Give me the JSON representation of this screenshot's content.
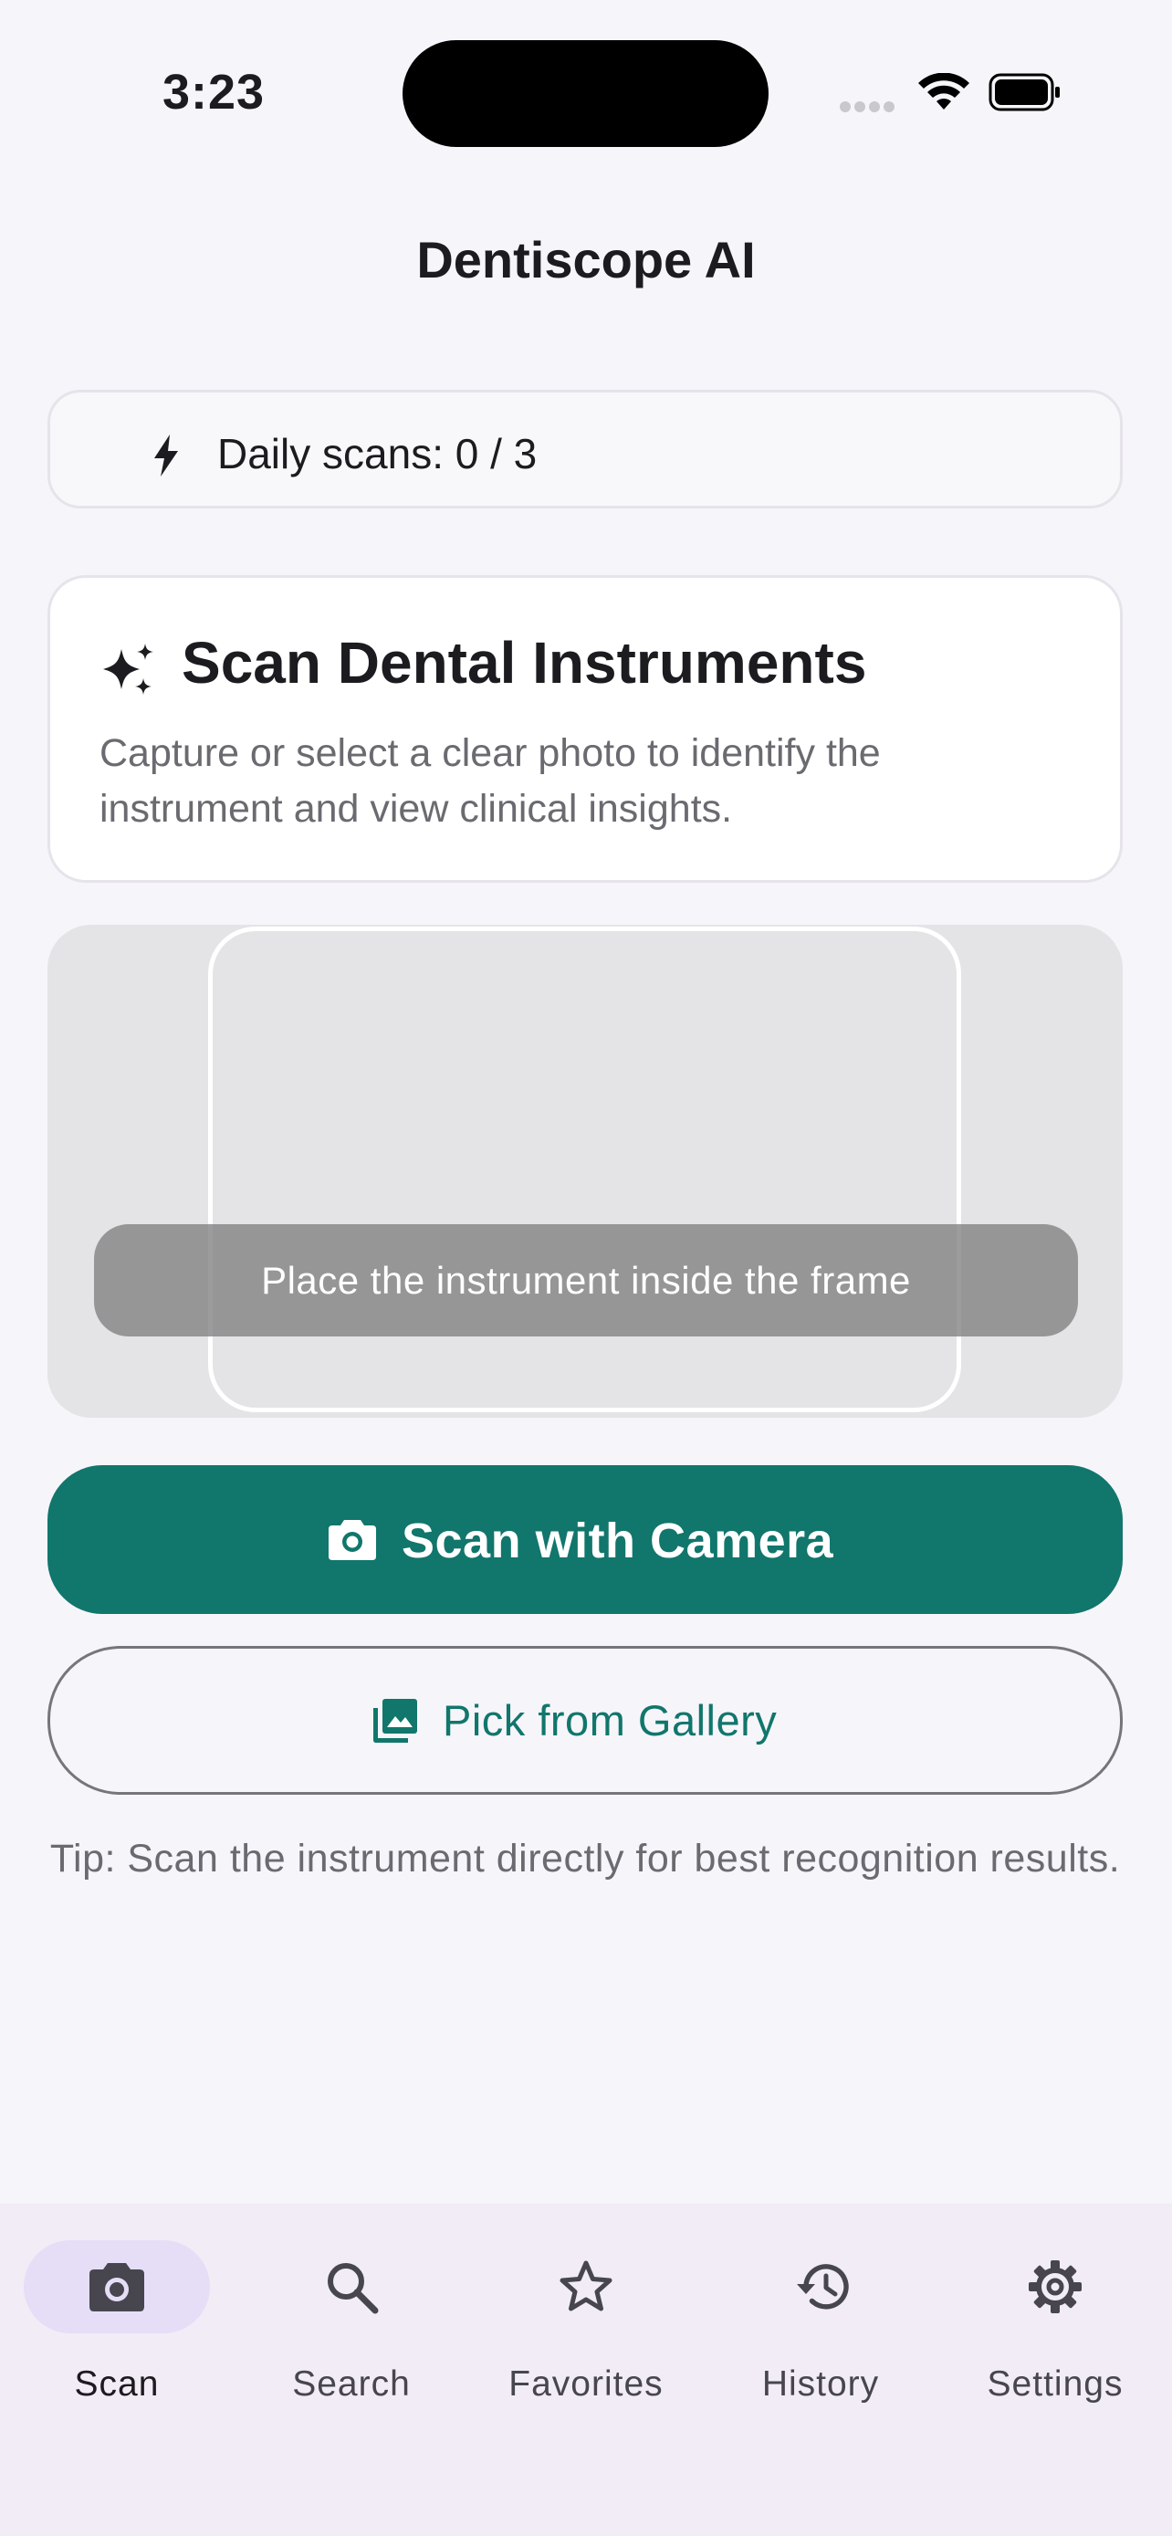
{
  "status_bar": {
    "time": "3:23"
  },
  "app": {
    "title": "Dentiscope AI"
  },
  "quota": {
    "icon": "bolt-icon",
    "text": "Daily scans: 0 / 3"
  },
  "intro_card": {
    "icon": "sparkle-icon",
    "title": "Scan Dental Instruments",
    "description": "Capture or select a clear photo to identify the instrument and view clinical insights."
  },
  "camera_preview": {
    "hint": "Place the instrument inside the frame"
  },
  "actions": {
    "camera_label": "Scan with Camera",
    "gallery_label": "Pick from Gallery"
  },
  "tip": "Tip: Scan the instrument directly for best recognition results.",
  "bottom_nav": {
    "items": [
      {
        "label": "Scan",
        "icon": "camera-icon",
        "active": true
      },
      {
        "label": "Search",
        "icon": "search-icon",
        "active": false
      },
      {
        "label": "Favorites",
        "icon": "star-icon",
        "active": false
      },
      {
        "label": "History",
        "icon": "history-icon",
        "active": false
      },
      {
        "label": "Settings",
        "icon": "gear-icon",
        "active": false
      }
    ]
  },
  "colors": {
    "primary": "#11766c",
    "background": "#f6f5fa",
    "nav_background": "#f1ecf6",
    "nav_active_indicator": "#e6def7"
  }
}
